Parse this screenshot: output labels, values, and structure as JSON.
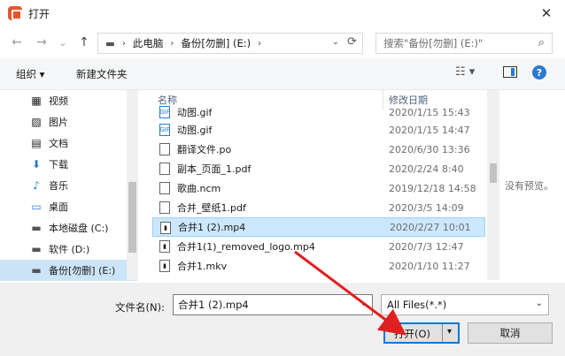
{
  "window": {
    "title": "打开",
    "close_glyph": "✕"
  },
  "nav": {
    "back": "←",
    "forward": "→",
    "dropdown": "⌄",
    "up": "↑",
    "address": {
      "drive_glyph": "▬",
      "segments": [
        "此电脑",
        "备份[勿删] (E:)"
      ],
      "separator": "›"
    },
    "search_placeholder": "搜索\"备份[勿删] (E:)\""
  },
  "toolbar": {
    "organize": "组织 ▾",
    "new_folder": "新建文件夹",
    "view_glyph": "☷ ▾",
    "help_glyph": "?"
  },
  "sidebar": {
    "items": [
      {
        "label": "视频",
        "icon": "video-icon",
        "glyph": "▦"
      },
      {
        "label": "图片",
        "icon": "picture-icon",
        "glyph": "▨"
      },
      {
        "label": "文档",
        "icon": "document-icon",
        "glyph": "▤"
      },
      {
        "label": "下载",
        "icon": "download-icon",
        "glyph": "⬇"
      },
      {
        "label": "音乐",
        "icon": "music-icon",
        "glyph": "♪"
      },
      {
        "label": "桌面",
        "icon": "desktop-icon",
        "glyph": "▭"
      },
      {
        "label": "本地磁盘 (C:)",
        "icon": "drive-icon",
        "glyph": "▬"
      },
      {
        "label": "软件 (D:)",
        "icon": "drive-icon",
        "glyph": "▬"
      },
      {
        "label": "备份[勿删] (E:)",
        "icon": "drive-icon",
        "glyph": "▬"
      }
    ]
  },
  "filelist": {
    "columns": {
      "name": "名称",
      "date": "修改日期"
    },
    "files": [
      {
        "name": "动图.gif",
        "date": "2020/1/15 15:43",
        "icon": "gif-file-icon",
        "glyph": "GIF"
      },
      {
        "name": "动图.gif",
        "date": "2020/1/15 14:47",
        "icon": "gif-file-icon",
        "glyph": "GIF"
      },
      {
        "name": "翻译文件.po",
        "date": "2020/6/30 13:36",
        "icon": "file-icon",
        "glyph": ""
      },
      {
        "name": "副本_页面_1.pdf",
        "date": "2020/2/24 8:40",
        "icon": "pdf-file-icon",
        "glyph": ""
      },
      {
        "name": "歌曲.ncm",
        "date": "2019/12/18 14:58",
        "icon": "file-icon",
        "glyph": ""
      },
      {
        "name": "合并_壁纸1.pdf",
        "date": "2020/3/5 14:09",
        "icon": "pdf-file-icon",
        "glyph": ""
      },
      {
        "name": "合并1 (2).mp4",
        "date": "2020/2/27 10:01",
        "icon": "video-file-icon",
        "glyph": "▮"
      },
      {
        "name": "合并1(1)_removed_logo.mp4",
        "date": "2020/7/3 12:47",
        "icon": "video-file-icon",
        "glyph": "▮"
      },
      {
        "name": "合并1.mkv",
        "date": "2020/1/10 11:27",
        "icon": "video-file-icon",
        "glyph": "▮"
      }
    ]
  },
  "preview": {
    "text": "没有预览。"
  },
  "footer": {
    "filename_label": "文件名(N):",
    "filename_value": "合并1 (2).mp4",
    "filter_value": "All Files(*.*)",
    "open_label": "打开(O)",
    "cancel_label": "取消",
    "dropdown_glyph": "⌄"
  },
  "colors": {
    "accent": "#0078d7",
    "selection": "#cce8ff",
    "arrow": "#e02020"
  }
}
